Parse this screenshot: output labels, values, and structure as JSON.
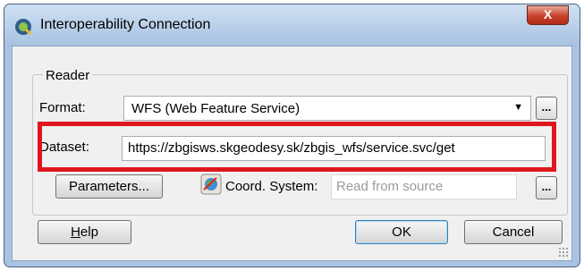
{
  "window": {
    "title": "Interoperability Connection",
    "close_label": "X"
  },
  "reader": {
    "group_label": "Reader",
    "format_label": "Format:",
    "format_value": "WFS (Web Feature Service)",
    "format_browse": "...",
    "dataset_label": "Dataset:",
    "dataset_value": "https://zbgisws.skgeodesy.sk/zbgis_wfs/service.svc/get",
    "parameters_label": "Parameters...",
    "coord_label": "Coord. System:",
    "coord_placeholder": "Read from source",
    "coord_browse": "..."
  },
  "buttons": {
    "help_prefix": "",
    "help_underlined": "H",
    "help_rest": "elp",
    "ok": "OK",
    "cancel": "Cancel"
  },
  "colors": {
    "highlight": "#e0161e",
    "titlebar": "#a9c4e3",
    "close": "#c7412b"
  }
}
